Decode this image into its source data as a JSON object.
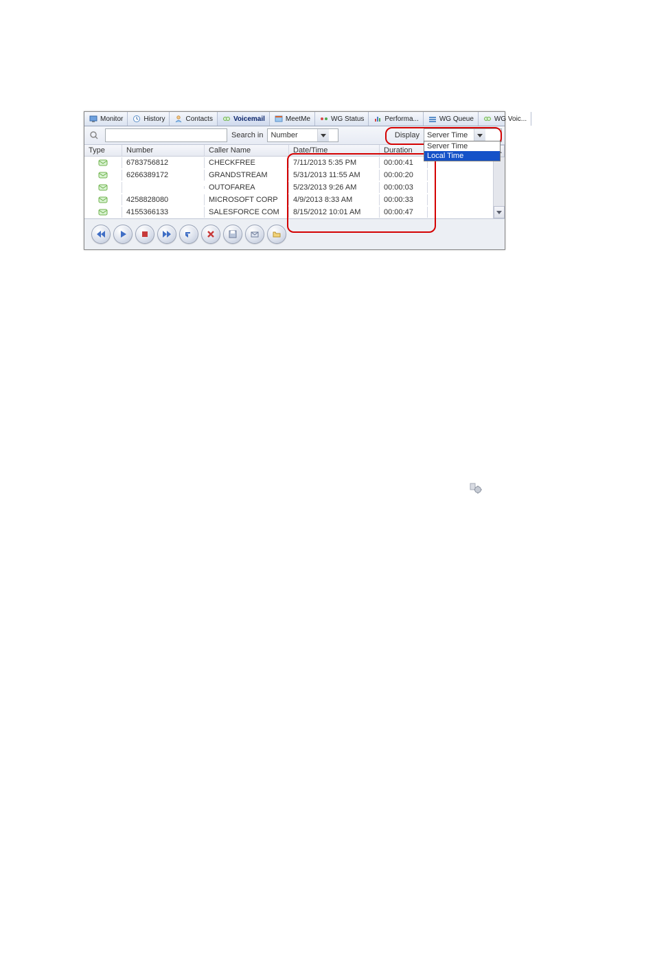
{
  "tabs": [
    {
      "label": "Monitor"
    },
    {
      "label": "History"
    },
    {
      "label": "Contacts"
    },
    {
      "label": "Voicemail"
    },
    {
      "label": "MeetMe"
    },
    {
      "label": "WG Status"
    },
    {
      "label": "Performa..."
    },
    {
      "label": "WG Queue"
    },
    {
      "label": "WG Voic..."
    }
  ],
  "filter": {
    "search_in_label": "Search in",
    "search_in_value": "Number",
    "display_label": "Display",
    "display_value": "Server Time",
    "display_options": [
      "Server Time",
      "Local Time"
    ]
  },
  "columns": {
    "type": "Type",
    "number": "Number",
    "caller": "Caller Name",
    "date": "Date/Time",
    "duration": "Duration"
  },
  "rows": [
    {
      "number": "6783756812",
      "caller": "CHECKFREE",
      "date": "7/11/2013 5:35 PM",
      "duration": "00:00:41"
    },
    {
      "number": "6266389172",
      "caller": "GRANDSTREAM",
      "date": "5/31/2013 11:55 AM",
      "duration": "00:00:20"
    },
    {
      "number": "",
      "caller": "OUTOFAREA",
      "date": "5/23/2013 9:26 AM",
      "duration": "00:00:03"
    },
    {
      "number": "4258828080",
      "caller": "MICROSOFT CORP",
      "date": "4/9/2013 8:33 AM",
      "duration": "00:00:33"
    },
    {
      "number": "4155366133",
      "caller": "SALESFORCE COM",
      "date": "8/15/2012 10:01 AM",
      "duration": "00:00:47"
    }
  ]
}
